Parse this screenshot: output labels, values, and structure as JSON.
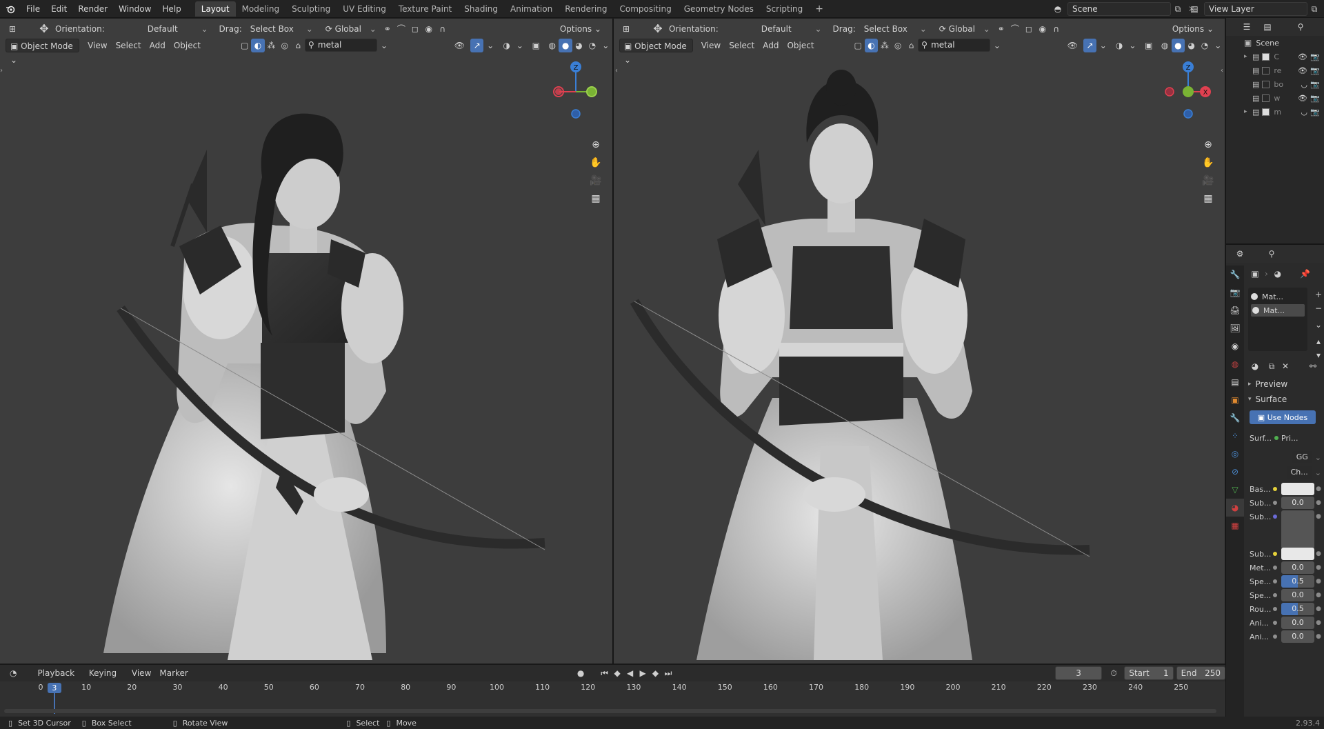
{
  "topbar": {
    "menus": [
      "File",
      "Edit",
      "Render",
      "Window",
      "Help"
    ],
    "workspaces": [
      "Layout",
      "Modeling",
      "Sculpting",
      "UV Editing",
      "Texture Paint",
      "Shading",
      "Animation",
      "Rendering",
      "Compositing",
      "Geometry Nodes",
      "Scripting"
    ],
    "active_workspace": "Layout",
    "add_tab": "+",
    "scene": "Scene",
    "view_layer": "View Layer"
  },
  "viewport_left": {
    "orientation_label": "Orientation:",
    "orientation_value": "Default",
    "drag_label": "Drag:",
    "drag_value": "Select Box",
    "transform_space": "Global",
    "options": "Options",
    "mode": "Object Mode",
    "menus": [
      "View",
      "Select",
      "Add",
      "Object"
    ],
    "search": "metal",
    "gizmo": {
      "z": "Z"
    }
  },
  "viewport_right": {
    "orientation_label": "Orientation:",
    "orientation_value": "Default",
    "drag_label": "Drag:",
    "drag_value": "Select Box",
    "transform_space": "Global",
    "options": "Options",
    "mode": "Object Mode",
    "menus": [
      "View",
      "Select",
      "Add",
      "Object"
    ],
    "search": "metal",
    "gizmo": {
      "z": "Z",
      "x": "X"
    }
  },
  "timeline": {
    "menus": [
      "Playback",
      "Keying",
      "View",
      "Marker"
    ],
    "current_frame": "3",
    "start_label": "Start",
    "start_value": "1",
    "end_label": "End",
    "end_value": "250",
    "ticks": [
      "0",
      "10",
      "20",
      "30",
      "40",
      "50",
      "60",
      "70",
      "80",
      "90",
      "100",
      "110",
      "120",
      "130",
      "140",
      "150",
      "160",
      "170",
      "180",
      "190",
      "200",
      "210",
      "220",
      "230",
      "240",
      "250"
    ],
    "playhead": "3"
  },
  "statusbar": {
    "items": [
      "Set 3D Cursor",
      "Box Select",
      "Rotate View",
      "Select",
      "Move"
    ],
    "version": "2.93.4"
  },
  "outliner": {
    "root": "Scene",
    "rows": [
      "C",
      "re",
      "bo",
      "w",
      "m"
    ]
  },
  "properties": {
    "materials": [
      "Mat...",
      "Mat..."
    ],
    "sections": {
      "preview": "Preview",
      "surface": "Surface"
    },
    "use_nodes": "Use Nodes",
    "surface_label": "Surf...",
    "surface_value": "Pri...",
    "distribution": "GG",
    "subsurface_method": "Ch...",
    "rows": [
      {
        "label": "Bas...",
        "value": ""
      },
      {
        "label": "Sub...",
        "value": "0.0"
      },
      {
        "label": "Sub...",
        "value": ""
      },
      {
        "label": "Sub...",
        "value": ""
      },
      {
        "label": "Met...",
        "value": "0.0"
      },
      {
        "label": "Spe...",
        "value": "0.5"
      },
      {
        "label": "Spe...",
        "value": "0.0"
      },
      {
        "label": "Rou...",
        "value": "0.5"
      },
      {
        "label": "Ani...",
        "value": "0.0"
      },
      {
        "label": "Ani...",
        "value": "0.0"
      }
    ]
  },
  "colors": {
    "accent": "#4772b3",
    "viewport_bg": "#3d3d3d",
    "axis_x": "#e04050",
    "axis_y": "#7ab334",
    "axis_z": "#3a7fd6"
  }
}
